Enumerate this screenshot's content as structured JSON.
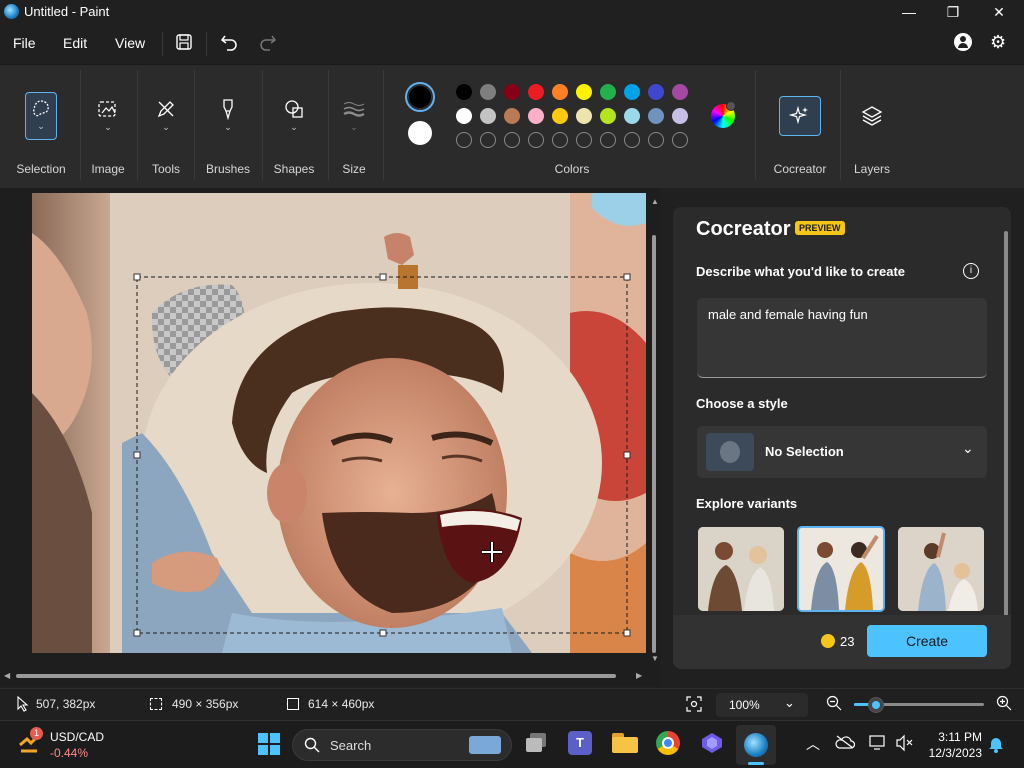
{
  "window": {
    "title": "Untitled - Paint",
    "minimize_glyph": "—",
    "maximize_glyph": "❐",
    "close_glyph": "✕"
  },
  "menu": {
    "file": "File",
    "edit": "Edit",
    "view": "View"
  },
  "ribbon": {
    "groups": {
      "selection": "Selection",
      "image": "Image",
      "tools": "Tools",
      "brushes": "Brushes",
      "shapes": "Shapes",
      "size": "Size",
      "colors": "Colors",
      "cocreator": "Cocreator",
      "layers": "Layers"
    },
    "primary_color": "#000000",
    "secondary_color": "#ffffff",
    "palette_row1": [
      "#000000",
      "#7f7f7f",
      "#880015",
      "#ed1c24",
      "#ff7f27",
      "#fff200",
      "#22b14c",
      "#00a2e8",
      "#3f48cc",
      "#a349a4"
    ],
    "palette_row2": [
      "#ffffff",
      "#c3c3c3",
      "#b97a57",
      "#ffaec9",
      "#ffc90e",
      "#efe4b0",
      "#b5e61d",
      "#99d9ea",
      "#7092be",
      "#c8bfe7"
    ]
  },
  "cocreator": {
    "title": "Cocreator",
    "preview_badge": "PREVIEW",
    "describe_label": "Describe what you'd like to create",
    "prompt_text": "male and female having fun",
    "style_label": "Choose a style",
    "style_value": "No Selection",
    "variants_label": "Explore variants",
    "credits": "23",
    "create_button": "Create"
  },
  "status": {
    "cursor_pos": "507, 382px",
    "selection_size": "490 × 356px",
    "canvas_size": "614 × 460px",
    "zoom": "100%",
    "zoom_level": 0.17
  },
  "taskbar": {
    "stock_name": "USD/CAD",
    "stock_change": "-0.44%",
    "stock_badge": "1",
    "search_placeholder": "Search",
    "time": "3:11 PM",
    "date": "12/3/2023"
  }
}
